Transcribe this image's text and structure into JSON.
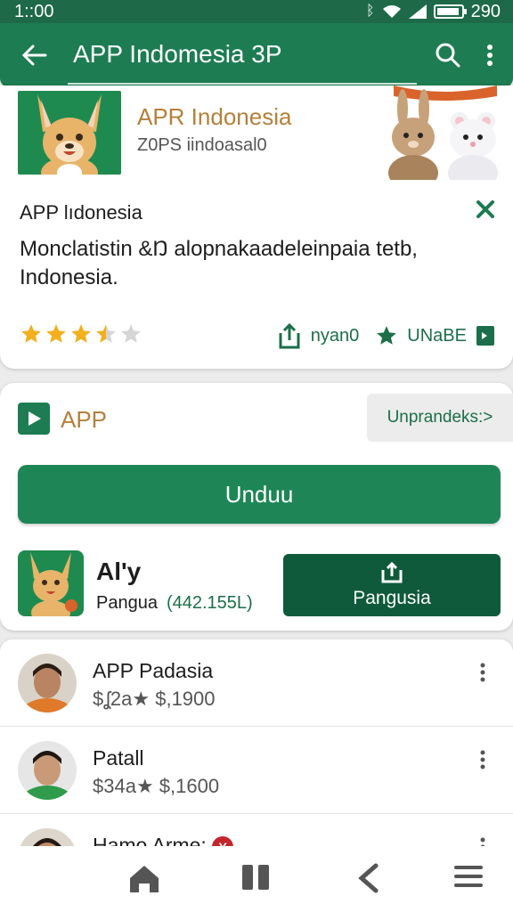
{
  "status": {
    "time": "1::00",
    "battery": "290"
  },
  "appbar": {
    "title": "APP Indomesia 3P"
  },
  "banner": {
    "app_name": "APR Indonesia",
    "developer": "Z0PS iindoasal0"
  },
  "details": {
    "title": "APP lıdonesia",
    "description": "Monclatistin &Ŋ alopnakaadeleinpaia tetb, Indonesia.",
    "rating": 3.5,
    "share_label": "nyan0",
    "wishlist_label": "UNaBE"
  },
  "install_card": {
    "label": "APP",
    "more_link": "Unprandeks:>",
    "install_label": "Unduu",
    "sub_app_name": "Al'y",
    "sub_app_category": "Pangua",
    "sub_app_count": "(442.155L)",
    "share_button_label": "Pangusia"
  },
  "list": {
    "items": [
      {
        "name": "APP Padasia",
        "price": "$ʆ2a★ $,1900"
      },
      {
        "name": "Patall",
        "price": "$34a★ $,1600"
      },
      {
        "name": "Hamo Arme:",
        "badge": "Y"
      }
    ]
  },
  "colors": {
    "brand": "#1d7c52",
    "accent": "#b5803b",
    "dark_button": "#0f5a3a"
  },
  "icons": [
    "back-arrow-icon",
    "search-icon",
    "more-vert-icon",
    "close-icon",
    "star-icon",
    "share-icon",
    "wishlist-star-icon",
    "play-icon",
    "home-icon",
    "recents-icon",
    "back-nav-icon",
    "menu-icon"
  ]
}
